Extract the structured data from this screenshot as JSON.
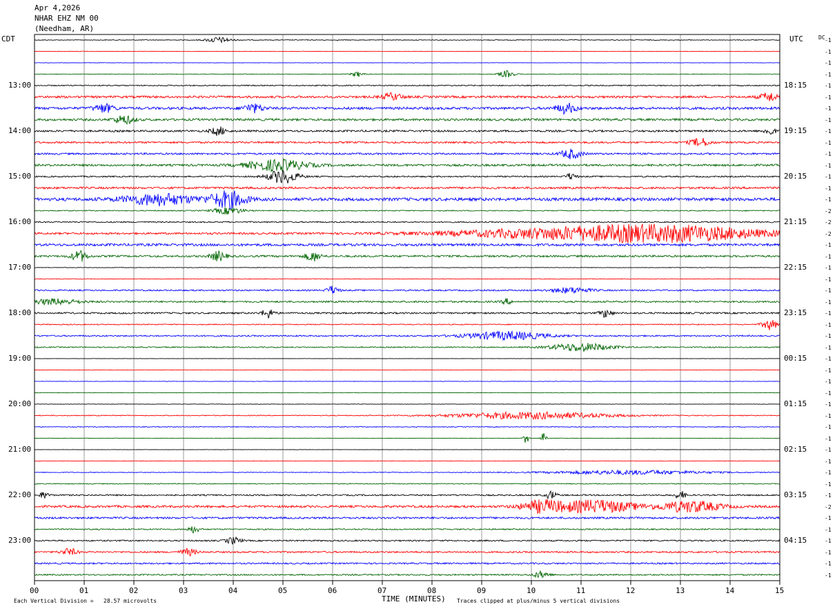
{
  "header": {
    "date": "Apr 4,2026",
    "station": "NHAR EHZ NM 00",
    "location": "(Needham, AR)"
  },
  "left_zone": "CDT",
  "right_zone": "UTC",
  "dc_label": "DC",
  "footer": {
    "scale_note": "Each Vertical Division =   28.57 microvolts",
    "x_title": "TIME (MINUTES)",
    "clip_note": "Traces clipped at plus/minus 5 vertical divisions"
  },
  "colors": {
    "black": "#000000",
    "red": "#ff0000",
    "blue": "#0000ff",
    "green": "#006400",
    "grid": "#9a9a9a"
  },
  "chart_data": {
    "type": "line",
    "xlabel": "TIME (MINUTES)",
    "xlim": [
      0,
      15
    ],
    "x_ticks": [
      "00",
      "01",
      "02",
      "03",
      "04",
      "05",
      "06",
      "07",
      "08",
      "09",
      "10",
      "11",
      "12",
      "13",
      "14",
      "15"
    ],
    "grid": true,
    "trace_minutes": 15,
    "series_colors": [
      "#000000",
      "#ff0000",
      "#0000ff",
      "#006400"
    ],
    "left_time_labels": [
      "13:00",
      "14:00",
      "15:00",
      "16:00",
      "17:00",
      "18:00",
      "19:00",
      "20:00",
      "21:00",
      "22:00",
      "23:00"
    ],
    "right_time_labels": [
      "18:15",
      "19:15",
      "20:15",
      "21:15",
      "22:15",
      "23:15",
      "00:15",
      "01:15",
      "02:15",
      "03:15",
      "04:15"
    ],
    "trace_offsets": [
      "-1",
      "-1",
      "-1",
      "-1",
      "-1",
      "-1",
      "-1",
      "-1",
      "-1",
      "-1",
      "-1",
      "-1",
      "-1",
      "-1",
      "-1",
      "-2",
      "-2",
      "-2",
      "-1",
      "-1",
      "-1",
      "-1",
      "-1",
      "-1",
      "-1",
      "-1",
      "-1",
      "-1",
      "-1",
      "-1",
      "-1",
      "-1",
      "-1",
      "-1",
      "-1",
      "-1",
      "-1",
      "-1",
      "-1",
      "-1",
      "-1",
      "-2",
      "-1",
      "-1",
      "-1",
      "-1",
      "-1",
      "-1"
    ],
    "trace_noise": [
      0.5,
      0.3,
      0.3,
      0.4,
      0.8,
      1.6,
      1.8,
      1.6,
      1.4,
      1.3,
      1.3,
      1.5,
      1.0,
      1.5,
      2.2,
      0.7,
      0.9,
      1.4,
      1.8,
      1.4,
      0.4,
      0.4,
      1.0,
      1.2,
      1.2,
      0.7,
      1.0,
      0.8,
      0.2,
      0.3,
      0.3,
      0.3,
      0.3,
      0.6,
      0.5,
      0.3,
      0.2,
      0.3,
      0.5,
      0.6,
      1.0,
      1.6,
      1.4,
      0.9,
      1.0,
      1.2,
      1.1,
      1.0
    ],
    "events": [
      {
        "trace": 0,
        "minute": 3.7,
        "amp": 4,
        "width": 0.25
      },
      {
        "trace": 3,
        "minute": 6.5,
        "amp": 4,
        "width": 0.12
      },
      {
        "trace": 3,
        "minute": 9.5,
        "amp": 5,
        "width": 0.15
      },
      {
        "trace": 5,
        "minute": 7.2,
        "amp": 5,
        "width": 0.2
      },
      {
        "trace": 5,
        "minute": 14.8,
        "amp": 6,
        "width": 0.2
      },
      {
        "trace": 6,
        "minute": 1.4,
        "amp": 6,
        "width": 0.2
      },
      {
        "trace": 6,
        "minute": 4.4,
        "amp": 6,
        "width": 0.2
      },
      {
        "trace": 6,
        "minute": 10.7,
        "amp": 7,
        "width": 0.2
      },
      {
        "trace": 7,
        "minute": 1.8,
        "amp": 6,
        "width": 0.2
      },
      {
        "trace": 8,
        "minute": 3.7,
        "amp": 6,
        "width": 0.15
      },
      {
        "trace": 8,
        "minute": 14.8,
        "amp": 6,
        "width": 0.1
      },
      {
        "trace": 9,
        "minute": 13.4,
        "amp": 6,
        "width": 0.2
      },
      {
        "trace": 10,
        "minute": 10.8,
        "amp": 7,
        "width": 0.2
      },
      {
        "trace": 11,
        "minute": 4.9,
        "amp": 8,
        "width": 0.6
      },
      {
        "trace": 12,
        "minute": 5.0,
        "amp": 10,
        "width": 0.3
      },
      {
        "trace": 12,
        "minute": 10.8,
        "amp": 5,
        "width": 0.1
      },
      {
        "trace": 14,
        "minute": 2.5,
        "amp": 8,
        "width": 0.7
      },
      {
        "trace": 14,
        "minute": 3.9,
        "amp": 12,
        "width": 0.35
      },
      {
        "trace": 15,
        "minute": 3.9,
        "amp": 5,
        "width": 0.3
      },
      {
        "trace": 17,
        "minute": 11.0,
        "amp": 8,
        "width": 2.5
      },
      {
        "trace": 17,
        "minute": 13.0,
        "amp": 8,
        "width": 1.8
      },
      {
        "trace": 19,
        "minute": 0.9,
        "amp": 8,
        "width": 0.15
      },
      {
        "trace": 19,
        "minute": 3.7,
        "amp": 7,
        "width": 0.15
      },
      {
        "trace": 19,
        "minute": 5.6,
        "amp": 7,
        "width": 0.15
      },
      {
        "trace": 22,
        "minute": 6.0,
        "amp": 6,
        "width": 0.12
      },
      {
        "trace": 22,
        "minute": 10.8,
        "amp": 4,
        "width": 0.4
      },
      {
        "trace": 23,
        "minute": 0.4,
        "amp": 4,
        "width": 0.5
      },
      {
        "trace": 23,
        "minute": 9.5,
        "amp": 4,
        "width": 0.1
      },
      {
        "trace": 24,
        "minute": 4.7,
        "amp": 7,
        "width": 0.12
      },
      {
        "trace": 24,
        "minute": 11.5,
        "amp": 6,
        "width": 0.12
      },
      {
        "trace": 25,
        "minute": 14.8,
        "amp": 8,
        "width": 0.15
      },
      {
        "trace": 26,
        "minute": 9.5,
        "amp": 6,
        "width": 0.8
      },
      {
        "trace": 27,
        "minute": 11.0,
        "amp": 6,
        "width": 0.6
      },
      {
        "trace": 33,
        "minute": 10.0,
        "amp": 5,
        "width": 1.6
      },
      {
        "trace": 35,
        "minute": 9.9,
        "amp": 8,
        "width": 0.05
      },
      {
        "trace": 35,
        "minute": 10.25,
        "amp": 10,
        "width": 0.05
      },
      {
        "trace": 38,
        "minute": 12.0,
        "amp": 3,
        "width": 1.6
      },
      {
        "trace": 40,
        "minute": 0.2,
        "amp": 5,
        "width": 0.1
      },
      {
        "trace": 40,
        "minute": 10.4,
        "amp": 6,
        "width": 0.1
      },
      {
        "trace": 40,
        "minute": 13.0,
        "amp": 6,
        "width": 0.1
      },
      {
        "trace": 41,
        "minute": 10.2,
        "amp": 8,
        "width": 0.4
      },
      {
        "trace": 41,
        "minute": 11.3,
        "amp": 9,
        "width": 0.8
      },
      {
        "trace": 41,
        "minute": 13.2,
        "amp": 8,
        "width": 0.6
      },
      {
        "trace": 43,
        "minute": 3.2,
        "amp": 5,
        "width": 0.12
      },
      {
        "trace": 44,
        "minute": 4.0,
        "amp": 5,
        "width": 0.15
      },
      {
        "trace": 45,
        "minute": 0.7,
        "amp": 5,
        "width": 0.15
      },
      {
        "trace": 45,
        "minute": 3.1,
        "amp": 5,
        "width": 0.15
      },
      {
        "trace": 47,
        "minute": 10.2,
        "amp": 5,
        "width": 0.15
      }
    ]
  }
}
